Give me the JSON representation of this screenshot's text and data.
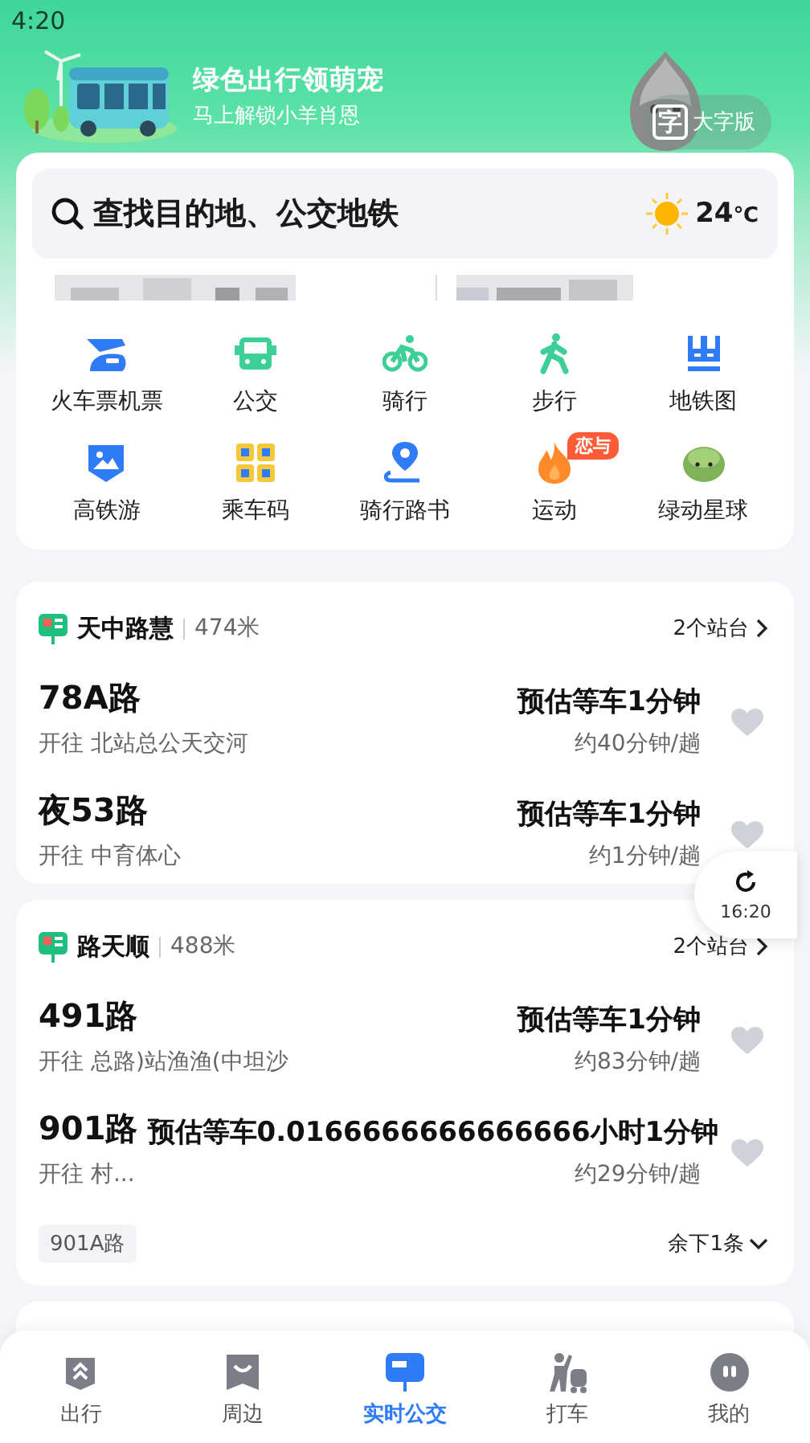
{
  "status_bar": {
    "time": "4:20"
  },
  "banner": {
    "title": "绿色出行领萌宠",
    "subtitle": "马上解锁小羊肖恩",
    "large_text_button": {
      "glyph": "字",
      "label": "大字版"
    }
  },
  "search": {
    "placeholder": "查找目的地、公交地铁",
    "weather": {
      "temperature": "24",
      "unit": "℃"
    }
  },
  "shortcuts": [
    {
      "kind": "train",
      "label": "火车票机票"
    },
    {
      "kind": "bus",
      "label": "公交"
    },
    {
      "kind": "bike",
      "label": "骑行"
    },
    {
      "kind": "walk",
      "label": "步行"
    },
    {
      "kind": "metro",
      "label": "地铁图"
    },
    {
      "kind": "scenery",
      "label": "高铁游"
    },
    {
      "kind": "qr",
      "label": "乘车码"
    },
    {
      "kind": "route",
      "label": "骑行路书"
    },
    {
      "kind": "flame",
      "label": "运动",
      "badge": "恋与"
    },
    {
      "kind": "planet",
      "label": "绿动星球"
    }
  ],
  "stations": [
    {
      "name": "天中路慧",
      "distance": "474米",
      "platforms": "2个站台",
      "routes": [
        {
          "name": "78A路",
          "destination": "开往 北站总公天交河",
          "eta": "预估等车1分钟",
          "frequency": "约40分钟/趟",
          "favorite": false
        },
        {
          "name": "夜53路",
          "destination": "开往 中育体心",
          "eta": "预估等车1分钟",
          "frequency": "约1分钟/趟",
          "favorite": false
        }
      ]
    },
    {
      "name": "路天顺",
      "distance": "488米",
      "platforms": "2个站台",
      "routes": [
        {
          "name": "491路",
          "destination": "开往 总路)站渔渔(中坦沙",
          "eta": "预估等车1分钟",
          "frequency": "约83分钟/趟",
          "favorite": false
        },
        {
          "name": "901路",
          "destination": "开往 村...",
          "eta": "预估等车0.0166666666666666小时1分钟",
          "frequency": "约29分钟/趟",
          "favorite": false
        }
      ],
      "more_tag": "901A路",
      "remaining": "余下1条"
    }
  ],
  "refresh": {
    "time": "16:20"
  },
  "tabs": [
    {
      "kind": "travel",
      "label": "出行",
      "selected": false
    },
    {
      "kind": "nearby",
      "label": "周边",
      "selected": false
    },
    {
      "kind": "bus",
      "label": "实时公交",
      "selected": true
    },
    {
      "kind": "taxi",
      "label": "打车",
      "selected": false
    },
    {
      "kind": "me",
      "label": "我的",
      "selected": false
    }
  ]
}
